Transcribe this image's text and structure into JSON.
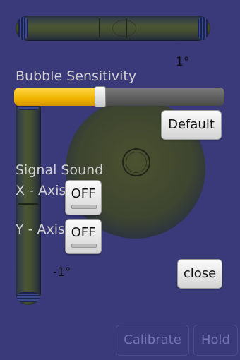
{
  "level": {
    "x_angle": "1°",
    "y_angle": "-1°"
  },
  "sensitivity": {
    "label": "Bubble Sensitivity",
    "value_percent": 41,
    "default_label": "Default"
  },
  "sound": {
    "label": "Signal Sound",
    "x_label": "X - Axis",
    "x_value": "OFF",
    "y_label": "Y - Axis",
    "y_value": "OFF"
  },
  "actions": {
    "close_label": "close",
    "calibrate_label": "Calibrate",
    "hold_label": "Hold"
  },
  "colors": {
    "background": "#3a3a7a",
    "slider_fill": "#f0b400"
  }
}
